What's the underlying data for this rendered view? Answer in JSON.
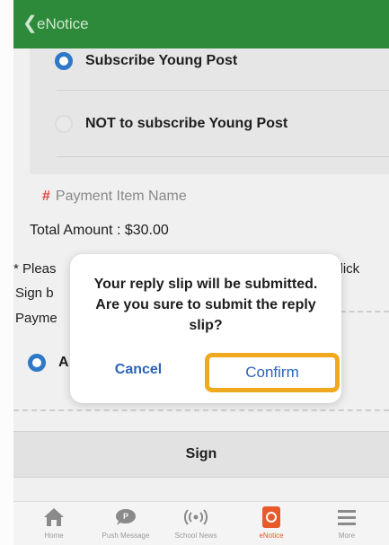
{
  "header": {
    "back_icon": "chevron-left-icon",
    "title": "eNotice"
  },
  "options": [
    {
      "label": "Subscribe Young Post",
      "selected": true
    },
    {
      "label": "NOT to subscribe Young Post",
      "selected": false
    }
  ],
  "payment": {
    "required_mark": "#",
    "item_name_label": "Payment Item Name",
    "total_label": "Total Amount : $30.00"
  },
  "notes": {
    "line1": "* Pleas",
    "line2": "Sign b",
    "line3": "Payme",
    "line1_tail": "click"
  },
  "agree": {
    "label": "A",
    "selected": true
  },
  "sign": {
    "label": "Sign"
  },
  "dialog": {
    "message": "Your reply slip will be submitted. Are you sure to submit the reply slip?",
    "cancel_label": "Cancel",
    "confirm_label": "Confirm",
    "highlight_color": "#f0a81f"
  },
  "nav": [
    {
      "label": "Home",
      "icon": "home-icon",
      "active": false
    },
    {
      "label": "Push Message",
      "icon": "chat-bubble-icon",
      "active": false
    },
    {
      "label": "School News",
      "icon": "broadcast-icon",
      "active": false
    },
    {
      "label": "eNotice",
      "icon": "enotice-icon",
      "active": true
    },
    {
      "label": "More",
      "icon": "menu-icon",
      "active": false
    }
  ],
  "colors": {
    "header": "#2e8a3b",
    "accent": "#2f78c8",
    "active_nav": "#e85a2a"
  }
}
